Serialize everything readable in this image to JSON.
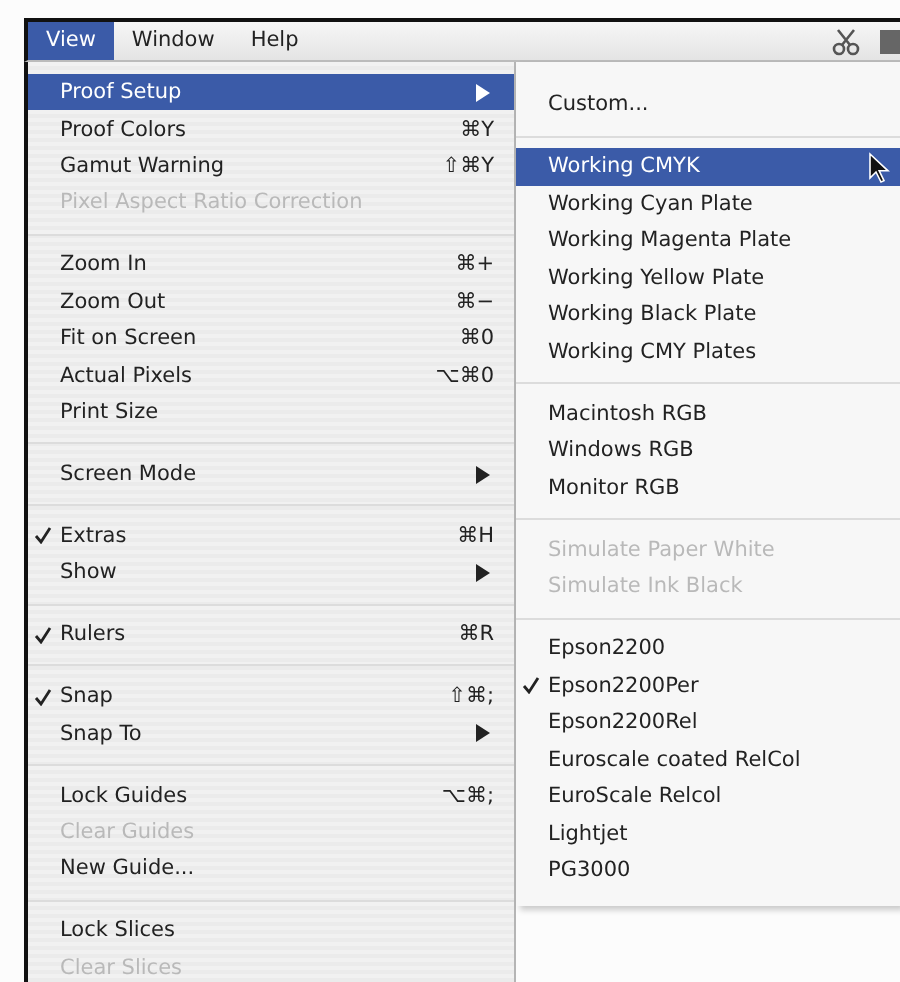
{
  "menubar": [
    {
      "label": "View",
      "selected": true
    },
    {
      "label": "Window",
      "selected": false
    },
    {
      "label": "Help",
      "selected": false
    }
  ],
  "view_menu": [
    {
      "kind": "item",
      "label": "Proof Setup",
      "has_submenu": true,
      "selected": true,
      "disabled": false,
      "checked": false
    },
    {
      "kind": "item",
      "label": "Proof Colors",
      "shortcut": "⌘Y",
      "selected": false,
      "disabled": false,
      "checked": false
    },
    {
      "kind": "item",
      "label": "Gamut Warning",
      "shortcut": "⇧⌘Y",
      "selected": false,
      "disabled": false,
      "checked": false
    },
    {
      "kind": "item",
      "label": "Pixel Aspect Ratio Correction",
      "selected": false,
      "disabled": true,
      "checked": false
    },
    {
      "kind": "separator"
    },
    {
      "kind": "item",
      "label": "Zoom In",
      "shortcut": "⌘+",
      "selected": false,
      "disabled": false,
      "checked": false
    },
    {
      "kind": "item",
      "label": "Zoom Out",
      "shortcut": "⌘−",
      "selected": false,
      "disabled": false,
      "checked": false
    },
    {
      "kind": "item",
      "label": "Fit on Screen",
      "shortcut": "⌘0",
      "selected": false,
      "disabled": false,
      "checked": false
    },
    {
      "kind": "item",
      "label": "Actual Pixels",
      "shortcut": "⌥⌘0",
      "selected": false,
      "disabled": false,
      "checked": false
    },
    {
      "kind": "item",
      "label": "Print Size",
      "selected": false,
      "disabled": false,
      "checked": false
    },
    {
      "kind": "separator"
    },
    {
      "kind": "item",
      "label": "Screen Mode",
      "has_submenu": true,
      "selected": false,
      "disabled": false,
      "checked": false
    },
    {
      "kind": "separator"
    },
    {
      "kind": "item",
      "label": "Extras",
      "shortcut": "⌘H",
      "selected": false,
      "disabled": false,
      "checked": true
    },
    {
      "kind": "item",
      "label": "Show",
      "has_submenu": true,
      "selected": false,
      "disabled": false,
      "checked": false
    },
    {
      "kind": "separator"
    },
    {
      "kind": "item",
      "label": "Rulers",
      "shortcut": "⌘R",
      "selected": false,
      "disabled": false,
      "checked": true
    },
    {
      "kind": "separator"
    },
    {
      "kind": "item",
      "label": "Snap",
      "shortcut": "⇧⌘;",
      "selected": false,
      "disabled": false,
      "checked": true
    },
    {
      "kind": "item",
      "label": "Snap To",
      "has_submenu": true,
      "selected": false,
      "disabled": false,
      "checked": false
    },
    {
      "kind": "separator"
    },
    {
      "kind": "item",
      "label": "Lock Guides",
      "shortcut": "⌥⌘;",
      "selected": false,
      "disabled": false,
      "checked": false
    },
    {
      "kind": "item",
      "label": "Clear Guides",
      "selected": false,
      "disabled": true,
      "checked": false
    },
    {
      "kind": "item",
      "label": "New Guide...",
      "selected": false,
      "disabled": false,
      "checked": false
    },
    {
      "kind": "separator"
    },
    {
      "kind": "item",
      "label": "Lock Slices",
      "selected": false,
      "disabled": false,
      "checked": false
    },
    {
      "kind": "item",
      "label": "Clear Slices",
      "selected": false,
      "disabled": true,
      "checked": false
    }
  ],
  "proof_setup_submenu": [
    {
      "kind": "item",
      "label": "Custom...",
      "selected": false,
      "disabled": false,
      "checked": false
    },
    {
      "kind": "separator"
    },
    {
      "kind": "item",
      "label": "Working CMYK",
      "selected": true,
      "disabled": false,
      "checked": false
    },
    {
      "kind": "item",
      "label": "Working Cyan Plate",
      "selected": false,
      "disabled": false,
      "checked": false
    },
    {
      "kind": "item",
      "label": "Working Magenta Plate",
      "selected": false,
      "disabled": false,
      "checked": false
    },
    {
      "kind": "item",
      "label": "Working Yellow Plate",
      "selected": false,
      "disabled": false,
      "checked": false
    },
    {
      "kind": "item",
      "label": "Working Black Plate",
      "selected": false,
      "disabled": false,
      "checked": false
    },
    {
      "kind": "item",
      "label": "Working CMY Plates",
      "selected": false,
      "disabled": false,
      "checked": false
    },
    {
      "kind": "separator"
    },
    {
      "kind": "item",
      "label": "Macintosh RGB",
      "selected": false,
      "disabled": false,
      "checked": false
    },
    {
      "kind": "item",
      "label": "Windows RGB",
      "selected": false,
      "disabled": false,
      "checked": false
    },
    {
      "kind": "item",
      "label": "Monitor RGB",
      "selected": false,
      "disabled": false,
      "checked": false
    },
    {
      "kind": "separator"
    },
    {
      "kind": "item",
      "label": "Simulate Paper White",
      "selected": false,
      "disabled": true,
      "checked": false
    },
    {
      "kind": "item",
      "label": "Simulate Ink Black",
      "selected": false,
      "disabled": true,
      "checked": false
    },
    {
      "kind": "separator"
    },
    {
      "kind": "item",
      "label": "Epson2200",
      "selected": false,
      "disabled": false,
      "checked": false
    },
    {
      "kind": "item",
      "label": "Epson2200Per",
      "selected": false,
      "disabled": false,
      "checked": true
    },
    {
      "kind": "item",
      "label": "Epson2200Rel",
      "selected": false,
      "disabled": false,
      "checked": false
    },
    {
      "kind": "item",
      "label": "Euroscale coated RelCol",
      "selected": false,
      "disabled": false,
      "checked": false
    },
    {
      "kind": "item",
      "label": "EuroScale Relcol",
      "selected": false,
      "disabled": false,
      "checked": false
    },
    {
      "kind": "item",
      "label": "Lightjet",
      "selected": false,
      "disabled": false,
      "checked": false
    },
    {
      "kind": "item",
      "label": "PG3000",
      "selected": false,
      "disabled": false,
      "checked": false
    }
  ]
}
